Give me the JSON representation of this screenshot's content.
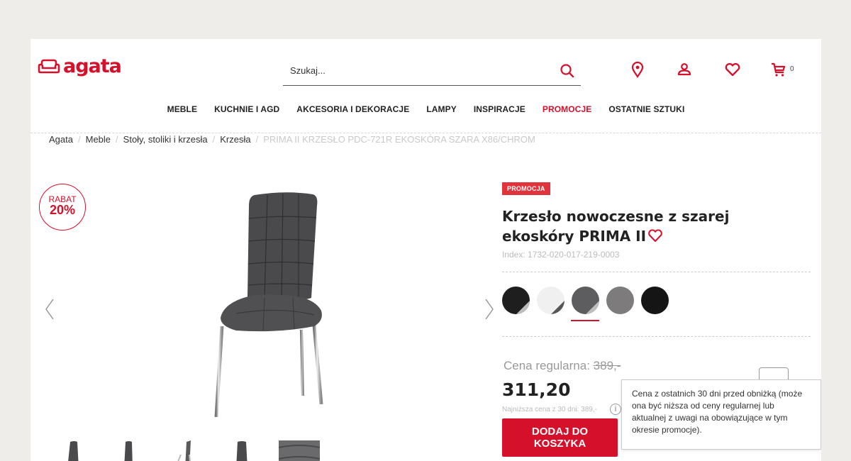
{
  "brand": {
    "logo_text": "agata",
    "color": "#d5102b"
  },
  "search": {
    "placeholder": "Szukaj..."
  },
  "header_icons": [
    "location-pin-icon",
    "account-icon",
    "heart-icon",
    "cart-icon"
  ],
  "cart": {
    "count": "0"
  },
  "nav": {
    "items": [
      "MEBLE",
      "KUCHNIE I AGD",
      "AKCESORIA I DEKORACJE",
      "LAMPY",
      "INSPIRACJE",
      "PROMOCJE",
      "OSTATNIE SZTUKI"
    ]
  },
  "breadcrumb": {
    "items": [
      "Agata",
      "Meble",
      "Stoły, stoliki i krzesła",
      "Krzesła"
    ],
    "current": "PRIMA II KRZESŁO PDC-721R EKOSKÓRA SZARA X86/CHROM",
    "separator": "/"
  },
  "badge": {
    "line1": "RABAT",
    "line2": "20%"
  },
  "product": {
    "tag": "PROMOCJA",
    "title": "Krzesło nowoczesne z szarej ekoskóry PRIMA II",
    "index": "Index: 1732-020-017-219-0003",
    "swatches": [
      {
        "name": "black",
        "color": "#1e1e1e"
      },
      {
        "name": "white",
        "color": "#f0f0f0"
      },
      {
        "name": "grey",
        "color": "#5d5d5f"
      },
      {
        "name": "grey-fabric",
        "color": "#7d7b7c"
      },
      {
        "name": "black-fabric",
        "color": "#151515"
      }
    ],
    "selected_swatch": "grey",
    "regular_price_label": "Cena regularna:",
    "regular_price": "389,-",
    "price": "311,20",
    "lowest_price": "Najniższa cena z 30 dni: 389,-",
    "info_symbol": "i",
    "add_to_cart": "DODAJ DO KOSZYKA"
  },
  "tooltip": {
    "text": "Cena z ostatnich 30 dni przed obniżką (może ona być niższa od ceny regularnej lub aktualnej z uwagi na obowiązujące w tym okresie promocje)."
  }
}
